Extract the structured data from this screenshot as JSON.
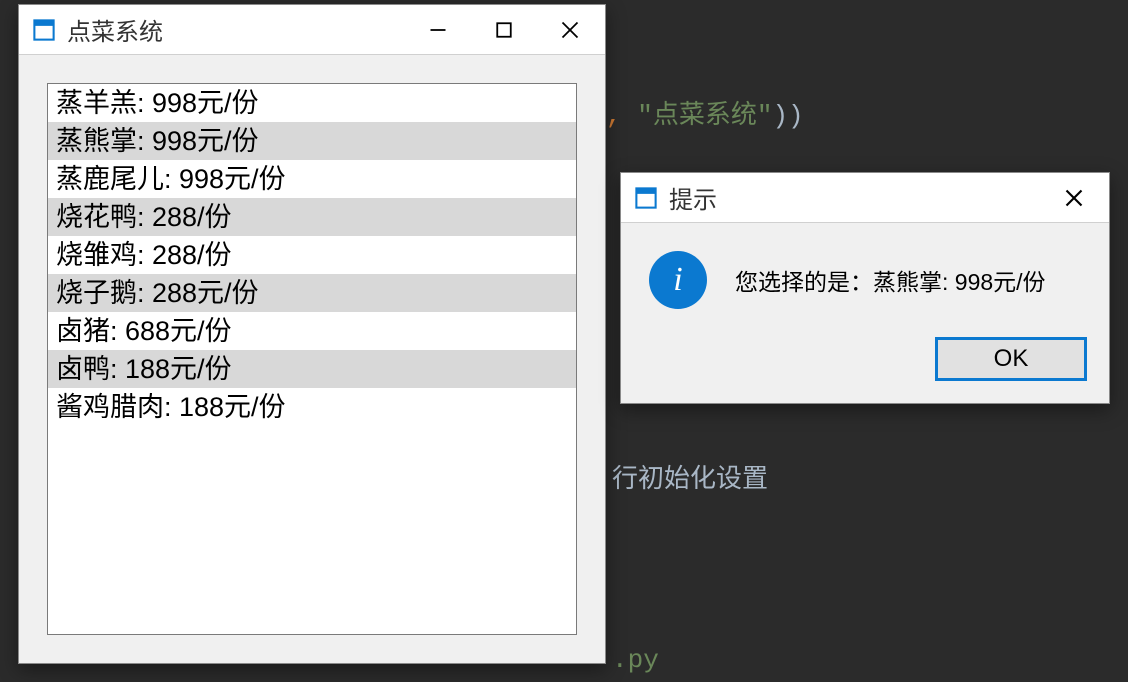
{
  "code_bg": {
    "line1_prefix": ", ",
    "line1_str": "\"点菜系统\"",
    "line1_suffix": "))",
    "line2": "行初始化设置",
    "line3": ".py"
  },
  "main_window": {
    "title": "点菜系统",
    "items": [
      "蒸羊羔: 998元/份",
      "蒸熊掌: 998元/份",
      "蒸鹿尾儿: 998元/份",
      "烧花鸭: 288/份",
      "烧雏鸡: 288/份",
      "烧子鹅: 288元/份",
      "卤猪: 688元/份",
      "卤鸭: 188元/份",
      "酱鸡腊肉: 188元/份"
    ]
  },
  "dialog": {
    "title": "提示",
    "message": "您选择的是：蒸熊掌: 998元/份",
    "ok_label": "OK"
  }
}
